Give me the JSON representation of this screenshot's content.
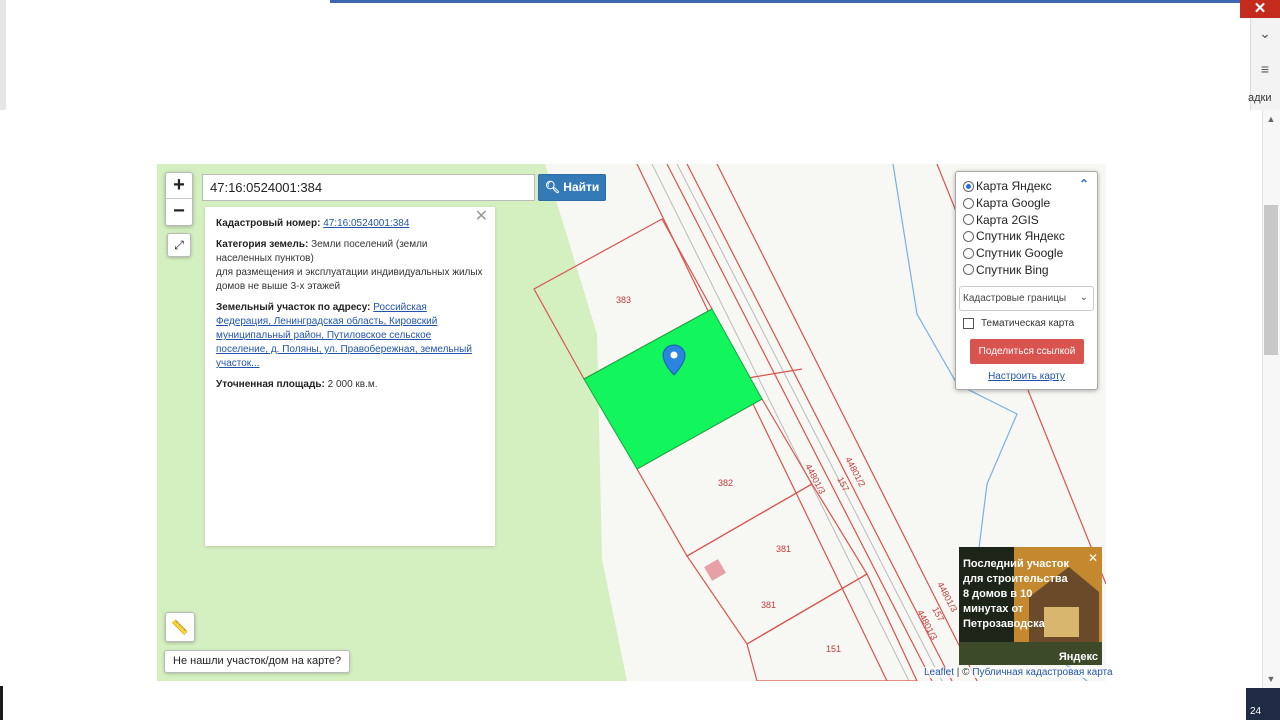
{
  "window": {
    "close_glyph": "✕",
    "chevron_glyph": "⌄",
    "menu_glyph": "≡",
    "partial_text": "адки",
    "taskbar_text": "24"
  },
  "map": {
    "zoom_in": "+",
    "zoom_out": "−",
    "fullscreen_glyph": "⤢",
    "ruler_glyph": "📏",
    "not_found_button": "Не нашли участок/дом на карте?",
    "parcel_labels": [
      "383",
      "382",
      "381",
      "381",
      "151",
      "44801/3",
      "44801/2",
      "157",
      "44801/3",
      "157",
      "44801/3"
    ],
    "highlight_color": "#12f55c",
    "boundary_color": "#d9534f"
  },
  "search": {
    "value": "47:16:0524001:384",
    "button_label": "Найти",
    "button_icon": "search-icon"
  },
  "info": {
    "close_glyph": "✕",
    "cadastral_label": "Кадастровый номер:",
    "cadastral_value": "47:16:0524001:384",
    "category_label": "Категория земель:",
    "category_value": "Земли поселений (земли населенных пунктов)",
    "usage": "для размещения и эксплуатации индивидуальных жилых домов не выше 3-х этажей",
    "address_label": "Земельный участок по адресу:",
    "address_value": "Российская Федерация, Ленинградская область, Кировский муниципальный район, Путиловское сельское поселение, д. Поляны, ул. Правобережная, земельный участок...",
    "area_label": "Уточненная площадь:",
    "area_value": "2 000 кв.м."
  },
  "layers": {
    "collapse_glyph": "⌃",
    "options": [
      {
        "label": "Карта Яндекс",
        "selected": true
      },
      {
        "label": "Карта Google",
        "selected": false
      },
      {
        "label": "Карта 2GIS",
        "selected": false
      },
      {
        "label": "Спутник Яндекс",
        "selected": false
      },
      {
        "label": "Спутник Google",
        "selected": false
      },
      {
        "label": "Спутник Bing",
        "selected": false
      }
    ],
    "select_value": "Кадастровые границы",
    "thematic_label": "Тематическая карта",
    "share_button": "Поделиться ссылкой",
    "setup_link": "Настроить карту"
  },
  "ad": {
    "text": "Последний участок для строительства 8 домов в 10 минутах от Петрозаводска",
    "brand": "Яндекс",
    "close_glyph": "✕"
  },
  "attribution": {
    "leaflet": "Leaflet",
    "separator": " | © ",
    "source": "Публичная кадастровая карта"
  }
}
